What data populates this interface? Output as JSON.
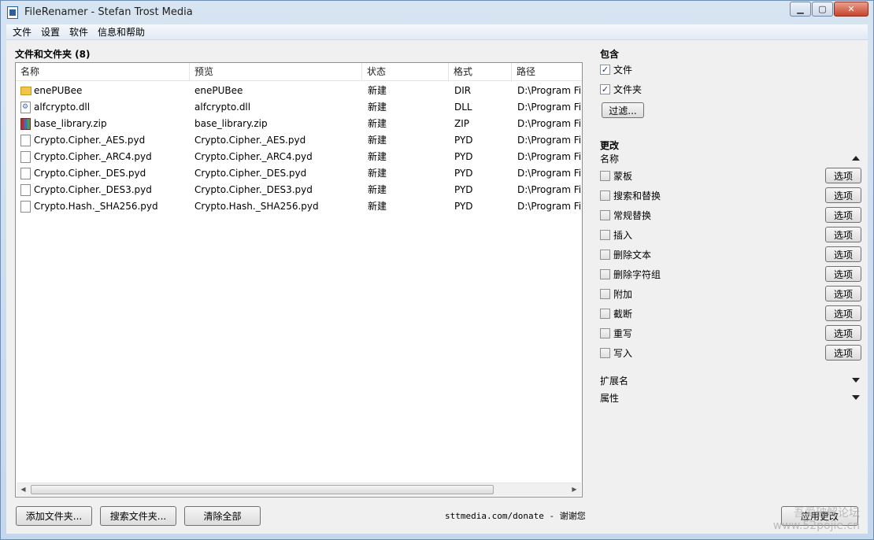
{
  "window": {
    "title": "FileRenamer - Stefan Trost Media",
    "minimize": "▁",
    "maximize": "▢",
    "close": "✕"
  },
  "menu": [
    "文件",
    "设置",
    "软件",
    "信息和帮助"
  ],
  "files_section": {
    "title": "文件和文件夹  (8)"
  },
  "columns": [
    "名称",
    "预览",
    "状态",
    "格式",
    "路径"
  ],
  "rows": [
    {
      "icon": "folder-icon",
      "name": "enePUBee",
      "preview": "enePUBee",
      "status": "新建",
      "format": "DIR",
      "path": "D:\\Program Fi"
    },
    {
      "icon": "dll-file-icon",
      "name": "alfcrypto.dll",
      "preview": "alfcrypto.dll",
      "status": "新建",
      "format": "DLL",
      "path": "D:\\Program Fi"
    },
    {
      "icon": "zip-archive-icon",
      "name": "base_library.zip",
      "preview": "base_library.zip",
      "status": "新建",
      "format": "ZIP",
      "path": "D:\\Program Fi"
    },
    {
      "icon": "file-icon",
      "name": "Crypto.Cipher._AES.pyd",
      "preview": "Crypto.Cipher._AES.pyd",
      "status": "新建",
      "format": "PYD",
      "path": "D:\\Program Fi"
    },
    {
      "icon": "file-icon",
      "name": "Crypto.Cipher._ARC4.pyd",
      "preview": "Crypto.Cipher._ARC4.pyd",
      "status": "新建",
      "format": "PYD",
      "path": "D:\\Program Fi"
    },
    {
      "icon": "file-icon",
      "name": "Crypto.Cipher._DES.pyd",
      "preview": "Crypto.Cipher._DES.pyd",
      "status": "新建",
      "format": "PYD",
      "path": "D:\\Program Fi"
    },
    {
      "icon": "file-icon",
      "name": "Crypto.Cipher._DES3.pyd",
      "preview": "Crypto.Cipher._DES3.pyd",
      "status": "新建",
      "format": "PYD",
      "path": "D:\\Program Fi"
    },
    {
      "icon": "file-icon",
      "name": "Crypto.Hash._SHA256.pyd",
      "preview": "Crypto.Hash._SHA256.pyd",
      "status": "新建",
      "format": "PYD",
      "path": "D:\\Program Fi"
    }
  ],
  "bottom_buttons": {
    "add_folder": "添加文件夹...",
    "search_folder": "搜索文件夹...",
    "clear_all": "清除全部"
  },
  "donate_link": "sttmedia.com/donate - 谢谢您",
  "include": {
    "title": "包含",
    "files": {
      "label": "文件",
      "checked": true
    },
    "folders": {
      "label": "文件夹",
      "checked": true
    },
    "filter_button": "过滤..."
  },
  "change": {
    "title": "更改",
    "name_section": "名称",
    "option_label": "选项",
    "items": [
      {
        "label": "蒙板",
        "checked": false
      },
      {
        "label": "搜索和替换",
        "checked": false
      },
      {
        "label": "常规替换",
        "checked": false
      },
      {
        "label": "插入",
        "checked": false
      },
      {
        "label": "删除文本",
        "checked": false
      },
      {
        "label": "删除字符组",
        "checked": false
      },
      {
        "label": "附加",
        "checked": false
      },
      {
        "label": "截断",
        "checked": false
      },
      {
        "label": "重写",
        "checked": false
      },
      {
        "label": "写入",
        "checked": false
      }
    ],
    "extension_section": "扩展名",
    "attributes_section": "属性"
  },
  "apply_button": "应用更改",
  "watermark": {
    "line1": "吾爱破解论坛",
    "line2": "www.52pojie.cn"
  }
}
